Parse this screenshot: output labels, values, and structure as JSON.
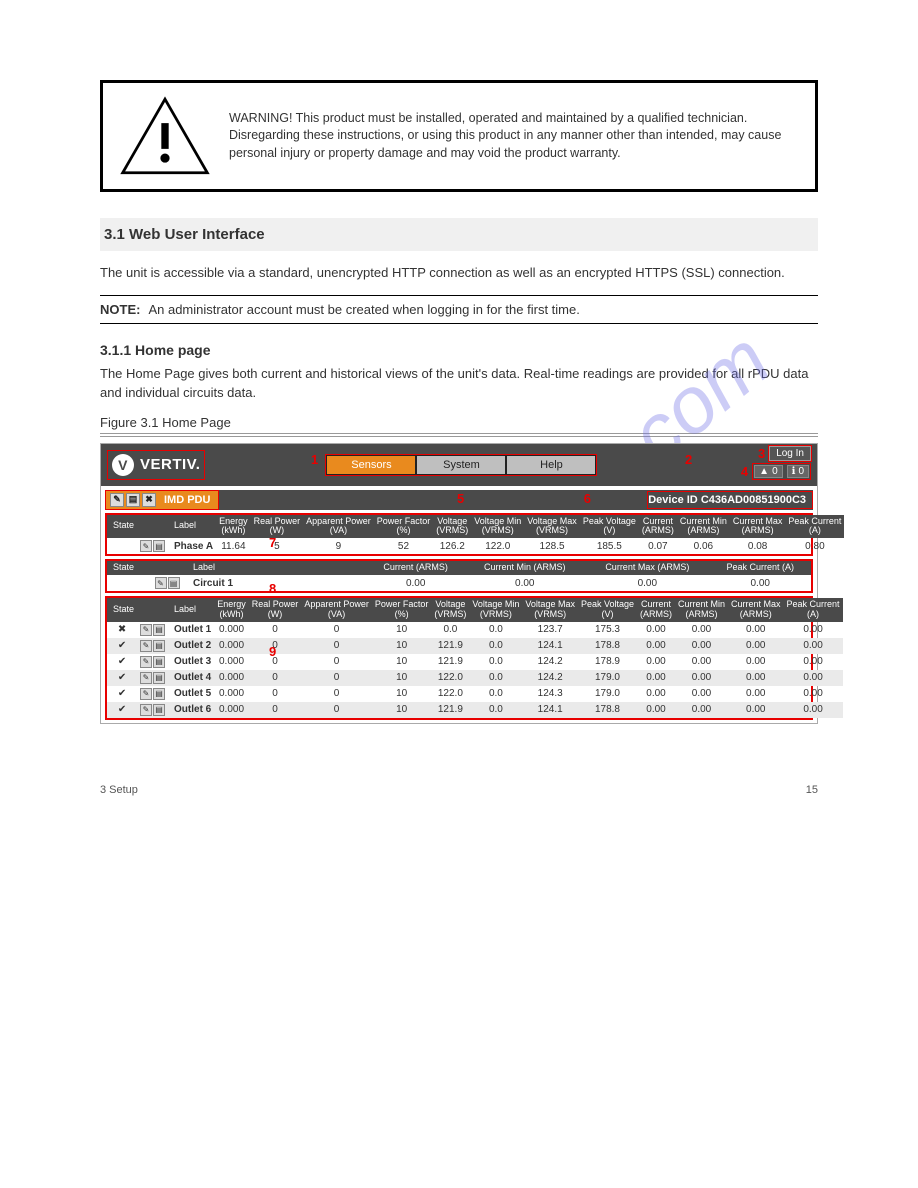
{
  "warning_text": "WARNING! This product must be installed, operated and maintained by a qualified technician. Disregarding these instructions, or using this product in any manner other than intended, may cause personal injury or property damage and may void the product warranty.",
  "section_title": "3.1 Web User Interface",
  "intro_text": "The unit is accessible via a standard, unencrypted HTTP connection as well as an encrypted HTTPS (SSL) connection.",
  "note_label": "NOTE:",
  "note_text": "An administrator account must be created when logging in for the first time.",
  "sub_heading": "3.1.1 Home page",
  "home_text": "The Home Page gives both current and historical views of the unit's data. Real-time readings are provided for all rPDU data and individual circuits data.",
  "figure_caption": "Figure 3.1 Home Page",
  "shot": {
    "brand": "VERTIV.",
    "tabs": [
      "Sensors",
      "System",
      "Help"
    ],
    "login": "Log In",
    "alarm_count": "0",
    "info_count": "0",
    "device_label": "IMD PDU",
    "device_id_prefix": "Device ID",
    "device_id": "C436AD00851900C3",
    "annotations": {
      "a1": "1",
      "a2": "2",
      "a3": "3",
      "a4": "4",
      "a5": "5",
      "a6": "6",
      "a7": "7",
      "a8": "8",
      "a9": "9"
    },
    "phase_headers": [
      "State",
      "",
      "Label",
      "Energy (kWh)",
      "Real Power (W)",
      "Apparent Power (VA)",
      "Power Factor (%)",
      "Voltage (VRMS)",
      "Voltage Min (VRMS)",
      "Voltage Max (VRMS)",
      "Peak Voltage (V)",
      "Current (ARMS)",
      "Current Min (ARMS)",
      "Current Max (ARMS)",
      "Peak Current (A)"
    ],
    "phase_row": {
      "label": "Phase A",
      "energy": "11.64",
      "real": "5",
      "app": "9",
      "pf": "52",
      "v": "126.2",
      "vmin": "122.0",
      "vmax": "128.5",
      "peakv": "185.5",
      "cur": "0.07",
      "curmin": "0.06",
      "curmax": "0.08",
      "peakc": "0.80"
    },
    "circuit_headers": [
      "State",
      "",
      "Label",
      "Current (ARMS)",
      "Current Min (ARMS)",
      "Current Max (ARMS)",
      "Peak Current (A)"
    ],
    "circuit_row": {
      "label": "Circuit 1",
      "cur": "0.00",
      "curmin": "0.00",
      "curmax": "0.00",
      "peakc": "0.00"
    },
    "outlet_headers": [
      "State",
      "",
      "Label",
      "Energy (kWh)",
      "Real Power (W)",
      "Apparent Power (VA)",
      "Power Factor (%)",
      "Voltage (VRMS)",
      "Voltage Min (VRMS)",
      "Voltage Max (VRMS)",
      "Peak Voltage (V)",
      "Current (ARMS)",
      "Current Min (ARMS)",
      "Current Max (ARMS)",
      "Peak Current (A)"
    ],
    "outlets": [
      {
        "state": "✖",
        "label": "Outlet 1",
        "energy": "0.000",
        "real": "0",
        "app": "0",
        "pf": "10",
        "v": "0.0",
        "vmin": "0.0",
        "vmax": "123.7",
        "peakv": "175.3",
        "cur": "0.00",
        "curmin": "0.00",
        "curmax": "0.00",
        "peakc": "0.00"
      },
      {
        "state": "✔",
        "label": "Outlet 2",
        "energy": "0.000",
        "real": "0",
        "app": "0",
        "pf": "10",
        "v": "121.9",
        "vmin": "0.0",
        "vmax": "124.1",
        "peakv": "178.8",
        "cur": "0.00",
        "curmin": "0.00",
        "curmax": "0.00",
        "peakc": "0.00"
      },
      {
        "state": "✔",
        "label": "Outlet 3",
        "energy": "0.000",
        "real": "0",
        "app": "0",
        "pf": "10",
        "v": "121.9",
        "vmin": "0.0",
        "vmax": "124.2",
        "peakv": "178.9",
        "cur": "0.00",
        "curmin": "0.00",
        "curmax": "0.00",
        "peakc": "0.00"
      },
      {
        "state": "✔",
        "label": "Outlet 4",
        "energy": "0.000",
        "real": "0",
        "app": "0",
        "pf": "10",
        "v": "122.0",
        "vmin": "0.0",
        "vmax": "124.2",
        "peakv": "179.0",
        "cur": "0.00",
        "curmin": "0.00",
        "curmax": "0.00",
        "peakc": "0.00"
      },
      {
        "state": "✔",
        "label": "Outlet 5",
        "energy": "0.000",
        "real": "0",
        "app": "0",
        "pf": "10",
        "v": "122.0",
        "vmin": "0.0",
        "vmax": "124.3",
        "peakv": "179.0",
        "cur": "0.00",
        "curmin": "0.00",
        "curmax": "0.00",
        "peakc": "0.00"
      },
      {
        "state": "✔",
        "label": "Outlet 6",
        "energy": "0.000",
        "real": "0",
        "app": "0",
        "pf": "10",
        "v": "121.9",
        "vmin": "0.0",
        "vmax": "124.1",
        "peakv": "178.8",
        "cur": "0.00",
        "curmin": "0.00",
        "curmax": "0.00",
        "peakc": "0.00"
      }
    ]
  },
  "footer_left": "3   Setup",
  "footer_right": "15"
}
